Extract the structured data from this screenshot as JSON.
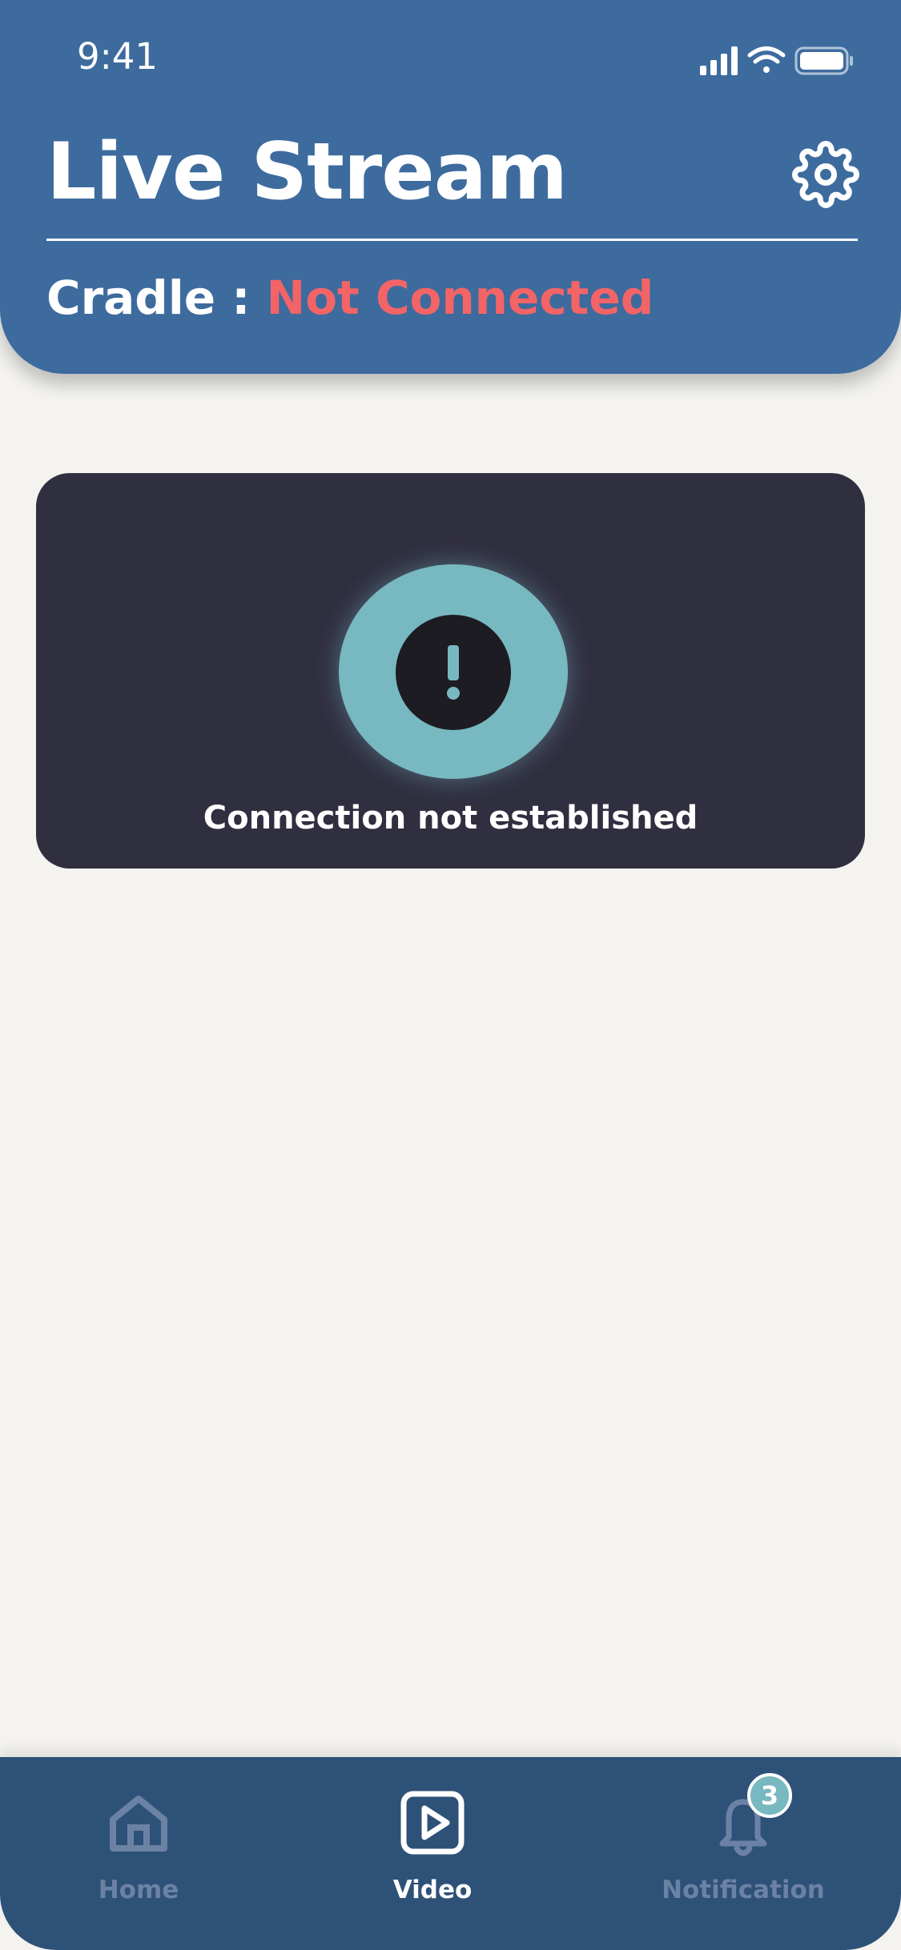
{
  "status_bar": {
    "time": "9:41"
  },
  "header": {
    "title": "Live Stream",
    "cradle_label": "Cradle",
    "separator": ":",
    "cradle_status": "Not Connected",
    "settings_icon": "gear-icon"
  },
  "video": {
    "message": "Connection not established",
    "icon": "alert-icon"
  },
  "tabbar": {
    "tabs": [
      {
        "label": "Home",
        "icon": "home-icon",
        "active": false
      },
      {
        "label": "Video",
        "icon": "play-icon",
        "active": true
      },
      {
        "label": "Notification",
        "icon": "bell-icon",
        "active": false,
        "badge": "3"
      }
    ]
  },
  "colors": {
    "header_bg": "#3d6b9e",
    "status_error": "#f36467",
    "card_bg": "#302f40",
    "accent": "#78b8c0",
    "tabbar_bg": "#2e5178"
  }
}
